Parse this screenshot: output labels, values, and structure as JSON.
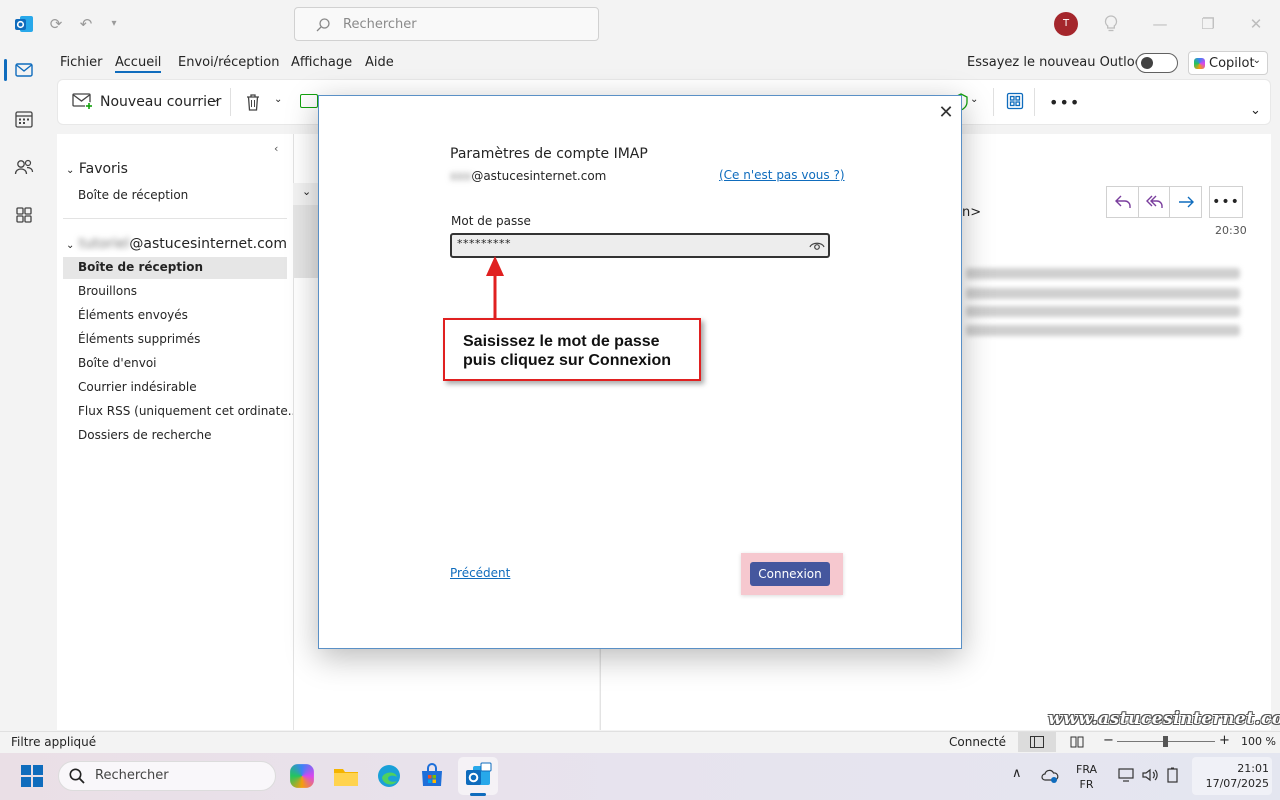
{
  "titlebar": {
    "search_placeholder": "Rechercher",
    "avatar_initial": "T"
  },
  "menu": {
    "items": [
      "Fichier",
      "Accueil",
      "Envoi/réception",
      "Affichage",
      "Aide"
    ],
    "try_new": "Essayez le nouveau Outlook",
    "copilot": "Copilot"
  },
  "ribbon": {
    "new_mail": "Nouveau courrier"
  },
  "folders": {
    "favorites_header": "Favoris",
    "favorites": [
      "Boîte de réception"
    ],
    "account_name_blurred": "tutoriel",
    "account_domain": "@astucesinternet.com",
    "items": [
      "Boîte de réception",
      "Brouillons",
      "Éléments envoyés",
      "Éléments supprimés",
      "Boîte d'envoi",
      "Courrier indésirable",
      "Flux RSS (uniquement cet ordinate...",
      "Dossiers de recherche"
    ]
  },
  "reading": {
    "time": "20:30",
    "partial_text": "n>"
  },
  "dialog": {
    "title": "Paramètres de compte IMAP",
    "email_blurred": "xxx",
    "email_domain": "@astucesinternet.com",
    "not_you": "(Ce n'est pas vous ?)",
    "password_label": "Mot de passe",
    "password_value": "*********",
    "previous": "Précédent",
    "connect": "Connexion"
  },
  "annotation": {
    "line1": "Saisissez le mot de passe",
    "line2": "puis cliquez sur Connexion"
  },
  "statusbar": {
    "filter": "Filtre appliqué",
    "status": "Connecté",
    "zoom": "100 %"
  },
  "watermark": "www.astucesinternet.com",
  "taskbar": {
    "search": "Rechercher",
    "lang_top": "FRA",
    "lang_bottom": "FR",
    "time": "21:01",
    "date": "17/07/2025"
  },
  "colors": {
    "accent": "#0f6cbd",
    "connect_button": "#45579e",
    "annotation_border": "#e02020",
    "avatar": "#a4262c"
  }
}
